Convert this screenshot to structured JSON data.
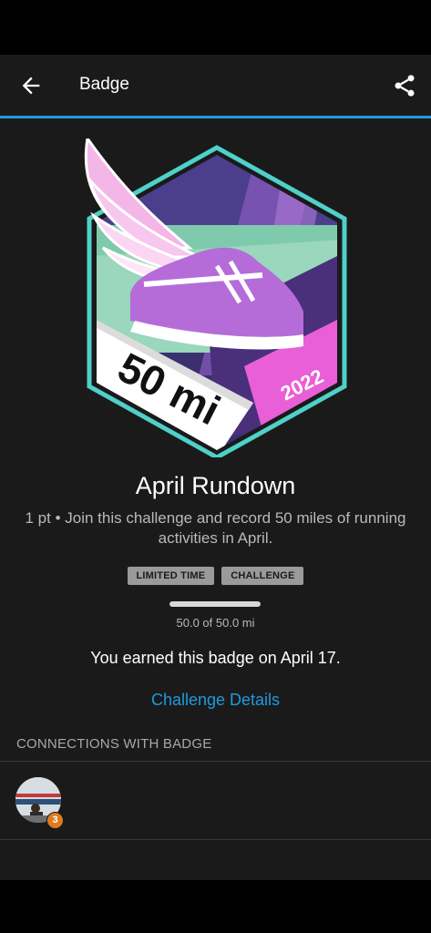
{
  "appbar": {
    "title": "Badge",
    "back_icon": "arrow-left-icon",
    "share_icon": "share-icon"
  },
  "badge_art": {
    "distance": "50 mi",
    "year": "2022"
  },
  "badge": {
    "name": "April Rundown",
    "description": "1 pt • Join this challenge and record 50 miles of running activities in April.",
    "tags": [
      "LIMITED TIME",
      "CHALLENGE"
    ],
    "progress_fraction": 1.0,
    "progress_text": "50.0 of 50.0 mi",
    "earned_text": "You earned this badge on April 17.",
    "details_link": "Challenge Details"
  },
  "connections": {
    "header": "CONNECTIONS WITH BADGE",
    "items": [
      {
        "avatar_count": "3"
      }
    ]
  },
  "colors": {
    "accent": "#1e9be0",
    "background": "#1a1a1a",
    "tag": "#9a9a9a",
    "avatar_badge": "#e07a1e"
  }
}
